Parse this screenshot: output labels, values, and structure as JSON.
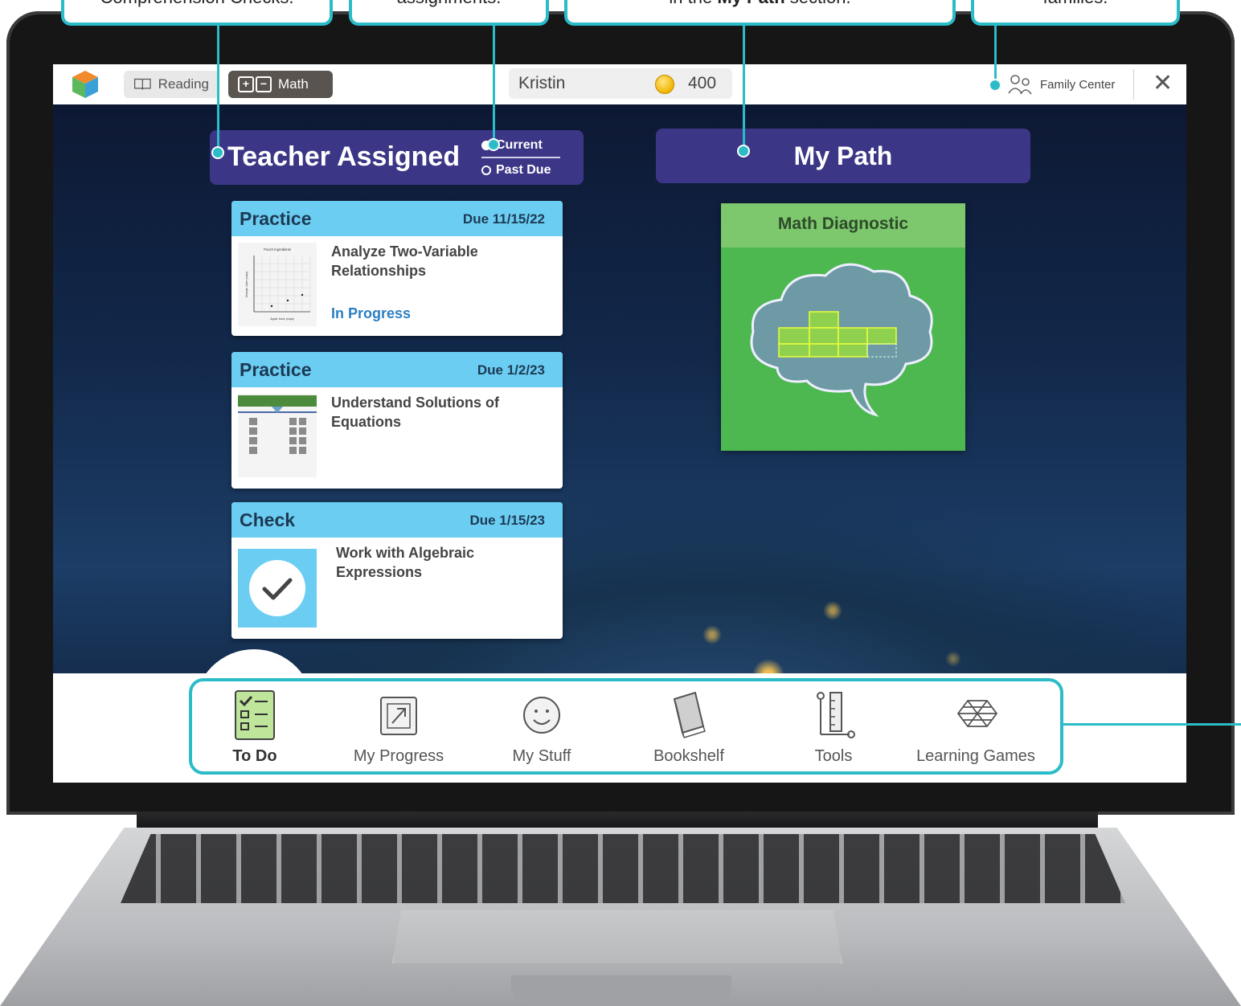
{
  "callouts": {
    "c1": "Comprehension Checks.",
    "c2": "assignments.",
    "c3_pre": "in the ",
    "c3_bold": "My Path",
    "c3_post": " section.",
    "c4": "families."
  },
  "topbar": {
    "reading_label": "Reading",
    "math_label": "Math",
    "user_name": "Kristin",
    "coins": "400",
    "family_center": "Family Center",
    "close_icon": "close-icon"
  },
  "teacher": {
    "title": "Teacher Assigned",
    "current_label": "Current",
    "past_due_label": "Past Due",
    "cards": [
      {
        "type": "Practice",
        "due": "Due 11/15/22",
        "title": "Analyze Two-Variable Relationships",
        "status": "In Progress"
      },
      {
        "type": "Practice",
        "due": "Due 1/2/23",
        "title": "Understand Solutions of Equations",
        "status": ""
      },
      {
        "type": "Check",
        "due": "Due 1/15/23",
        "title": "Work with Algebraic Expressions",
        "status": ""
      }
    ],
    "thumb1": {
      "title": "Punch Ingredients",
      "ylabel": "Orange Juice (cups)",
      "xlabel": "Apple Juice (cups)"
    }
  },
  "path": {
    "title": "My Path",
    "diagnostic_label": "Math Diagnostic"
  },
  "nav": {
    "items": [
      {
        "label": "To Do",
        "icon": "checklist-icon"
      },
      {
        "label": "My Progress",
        "icon": "arrow-up-right-icon"
      },
      {
        "label": "My Stuff",
        "icon": "smiley-icon"
      },
      {
        "label": "Bookshelf",
        "icon": "book-icon"
      },
      {
        "label": "Tools",
        "icon": "tools-icon"
      },
      {
        "label": "Learning Games",
        "icon": "games-icon"
      }
    ]
  },
  "colors": {
    "accent": "#2bbcc8",
    "header_purple": "#3b3686",
    "card_header": "#6ccdf2",
    "diagnostic_green": "#4db850"
  }
}
